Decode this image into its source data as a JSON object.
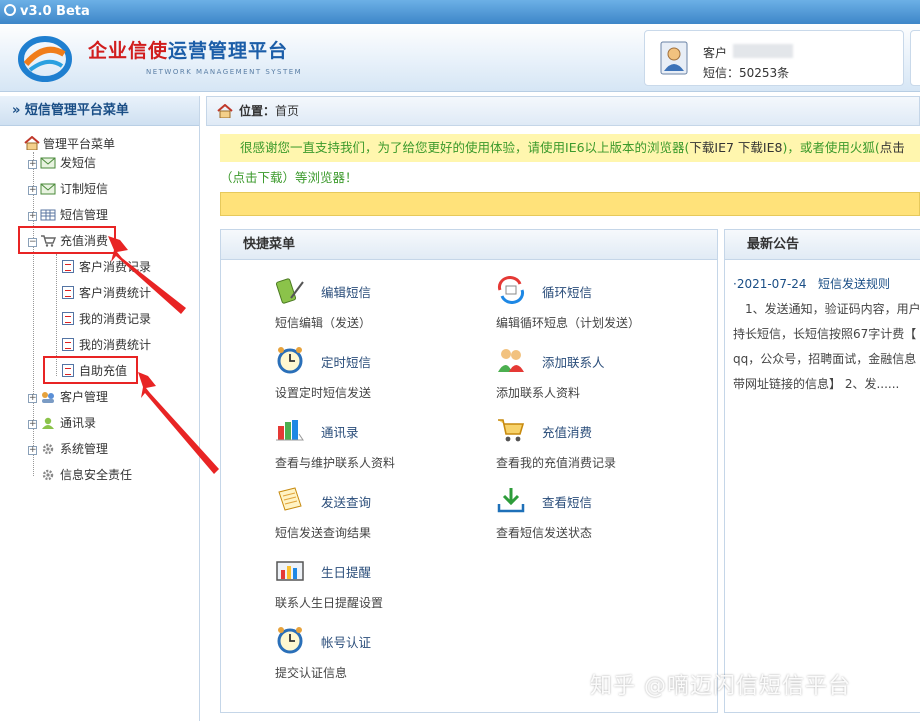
{
  "app": {
    "version": "v3.0 Beta",
    "brand_red": "企业信使",
    "brand_blue": "运营管理平台",
    "brand_sub": "NETWORK MANAGEMENT SYSTEM"
  },
  "user": {
    "label": "客户",
    "sms_count": "短信：50253条"
  },
  "sidebar": {
    "title": "» 短信管理平台菜单",
    "root": "管理平台菜单",
    "items": [
      {
        "label": "发短信",
        "icon": "envelope-icon"
      },
      {
        "label": "订制短信",
        "icon": "envelope-icon"
      },
      {
        "label": "短信管理",
        "icon": "table-icon"
      },
      {
        "label": "充值消费",
        "icon": "cart-icon"
      },
      {
        "label": "客户管理",
        "icon": "users-icon"
      },
      {
        "label": "通讯录",
        "icon": "contact-icon"
      },
      {
        "label": "系统管理",
        "icon": "gear-icon"
      },
      {
        "label": "信息安全责任",
        "icon": "gear-icon"
      }
    ],
    "subitems": [
      "客户消费记录",
      "客户消费统计",
      "我的消费记录",
      "我的消费统计",
      "自助充值"
    ]
  },
  "main": {
    "crumb_label": "位置：",
    "crumb_value": "首页",
    "notice_line1_a": "很感谢您一直支持我们，为了给您更好的使用体验，请使用IE6以上版本的浏览器(",
    "notice_line1_b": "下载IE7 下载IE8",
    "notice_line1_c": ")，或者使用火狐(",
    "notice_line1_d": "点击",
    "notice_line2": "（点击下载）等浏览器！"
  },
  "quick_menu": {
    "title": "快捷菜单",
    "items": [
      {
        "title": "编辑短信",
        "desc": "短信编辑（发送）",
        "icon": "phone-edit-icon"
      },
      {
        "title": "循环短信",
        "desc": "编辑循环短息（计划发送）",
        "icon": "loop-sms-icon"
      },
      {
        "title": "定时短信",
        "desc": "设置定时短信发送",
        "icon": "alarm-clock-icon"
      },
      {
        "title": "添加联系人",
        "desc": "添加联系人资料",
        "icon": "add-contact-icon"
      },
      {
        "title": "通讯录",
        "desc": "查看与维护联系人资料",
        "icon": "address-book-icon"
      },
      {
        "title": "充值消费",
        "desc": "查看我的充值消费记录",
        "icon": "cart-icon"
      },
      {
        "title": "发送查询",
        "desc": "短信发送查询结果",
        "icon": "send-query-icon"
      },
      {
        "title": "查看短信",
        "desc": "查看短信发送状态",
        "icon": "download-icon"
      },
      {
        "title": "生日提醒",
        "desc": "联系人生日提醒设置",
        "icon": "chart-icon"
      },
      {
        "title": "帐号认证",
        "desc": "提交认证信息",
        "icon": "alarm-clock-icon"
      }
    ]
  },
  "news": {
    "title": "最新公告",
    "date": "·2021-07-24",
    "headline": "短信发送规则",
    "body": "1、发送通知，验证码内容，用户持长短信，长短信按照67字计费【qq，公众号，招聘面试，金融信息带网址链接的信息】 2、发......",
    "lines": [
      "　1、发送通知，验证码内容，用户",
      "持长短信，长短信按照67字计费【",
      "qq，公众号，招聘面试，金融信息",
      "带网址链接的信息】 2、发......"
    ]
  },
  "watermark": "知乎 @嘀迈闪信短信平台",
  "colors": {
    "highlight": "#e82424",
    "notice_text": "#3c9a2c",
    "notice_bg": "#fff6ae",
    "brand_red": "#d11d1d",
    "brand_blue": "#1b5da8"
  }
}
